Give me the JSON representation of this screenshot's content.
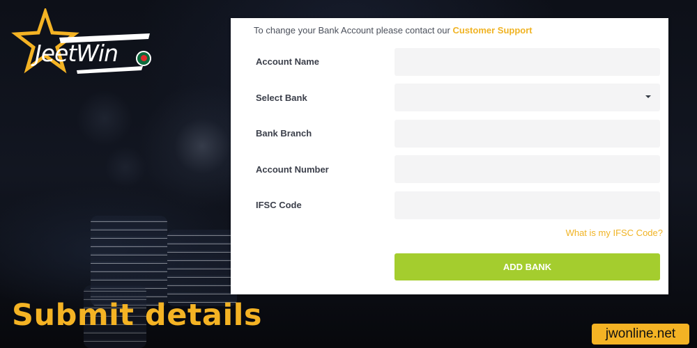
{
  "brand": {
    "logo_text": "JeetWin",
    "accent_color": "#f0b323",
    "flag_icon": "bangladesh-flag-icon"
  },
  "form": {
    "notice_prefix": "To change your Bank Account please contact our",
    "support_link": "Customer Support",
    "fields": [
      {
        "label": "Account Name",
        "value": "",
        "type": "text"
      },
      {
        "label": "Select Bank",
        "value": "",
        "type": "select"
      },
      {
        "label": "Bank Branch",
        "value": "",
        "type": "text"
      },
      {
        "label": "Account Number",
        "value": "",
        "type": "text"
      },
      {
        "label": "IFSC Code",
        "value": "",
        "type": "text"
      }
    ],
    "ifsc_help_link": "What is my IFSC Code?",
    "submit_label": "ADD BANK",
    "submit_color": "#a4cd2e"
  },
  "caption": "Submit details",
  "site_badge": "jwonline.net"
}
